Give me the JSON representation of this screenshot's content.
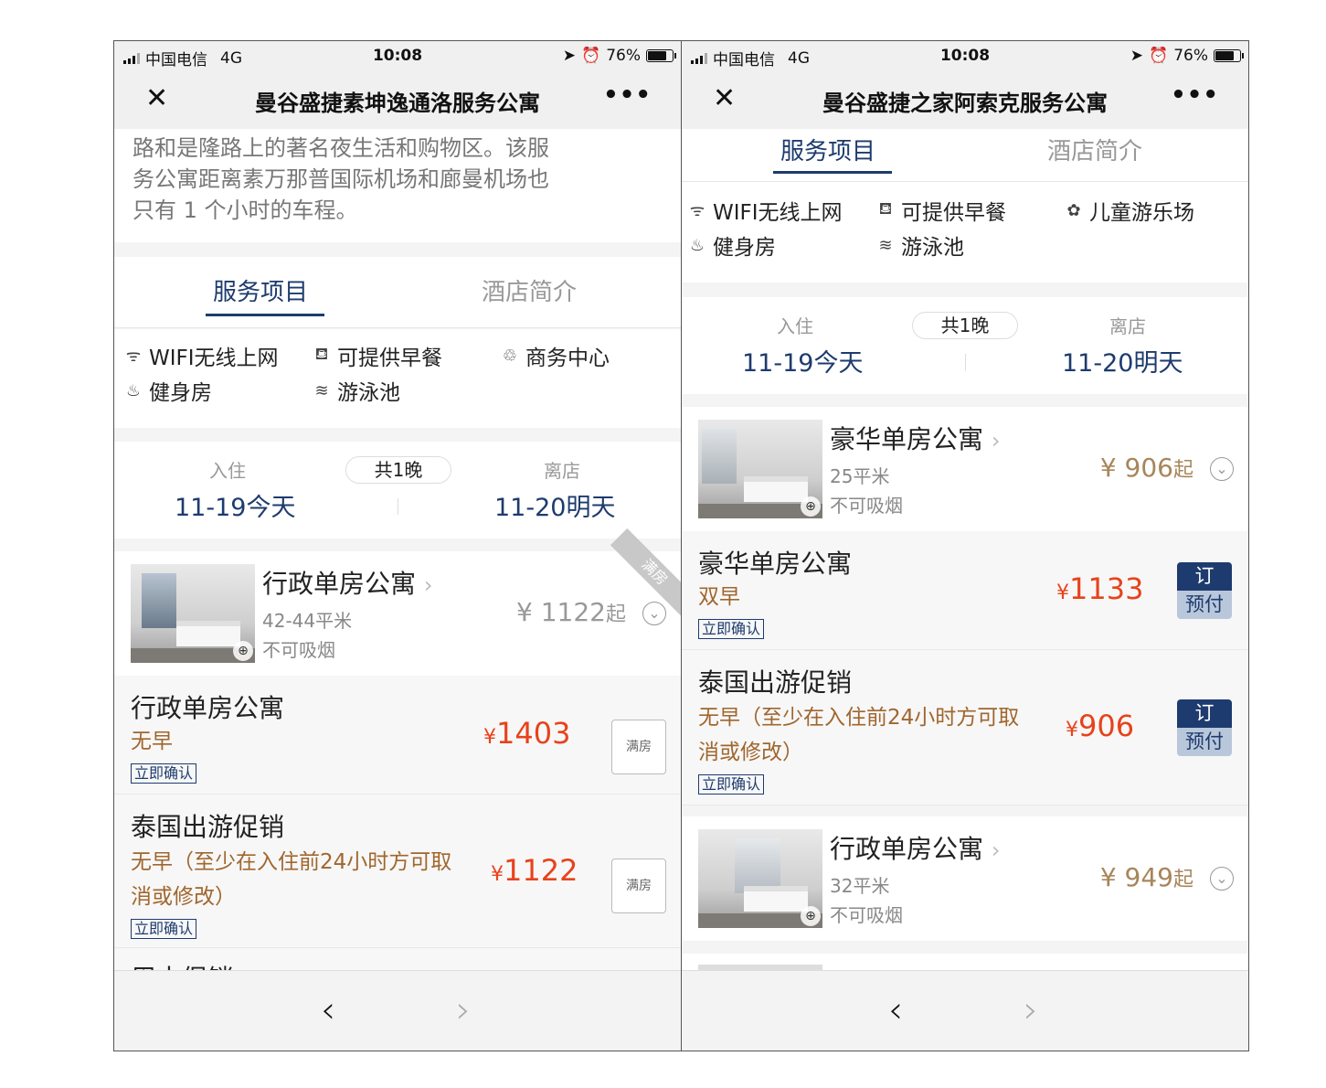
{
  "left": {
    "status": {
      "carrier": "中国电信",
      "network": "4G",
      "time": "10:08",
      "battery": "76%",
      "battery_level": 0.76
    },
    "nav": {
      "close": "✕",
      "title": "曼谷盛捷素坤逸通洛服务公寓",
      "more": "•••"
    },
    "description": [
      "路和是隆路上的著名夜生活和购物区。该服",
      "务公寓距离素万那普国际机场和廊曼机场也",
      "只有 1 个小时的车程。"
    ],
    "tabs": [
      "服务项目",
      "酒店简介"
    ],
    "facilities": [
      {
        "icon": "wifi-icon",
        "glyph": "ᯤ",
        "label": "WIFI无线上网"
      },
      {
        "icon": "breakfast-icon",
        "glyph": "⛾",
        "label": "可提供早餐"
      },
      {
        "icon": "business-icon",
        "glyph": "♲",
        "label": "商务中心"
      },
      {
        "icon": "gym-icon",
        "glyph": "♨",
        "label": "健身房"
      },
      {
        "icon": "pool-icon",
        "glyph": "≋",
        "label": "游泳池"
      }
    ],
    "dates": {
      "checkin_label": "入住",
      "checkin": "11-19今天",
      "nights": "共1晚",
      "checkout_label": "离店",
      "checkout": "11-20明天"
    },
    "room": {
      "name": "行政单房公寓",
      "chev": "›",
      "size": "42-44平米",
      "smoke": "不可吸烟",
      "price": "¥ 1122",
      "qi": "起",
      "ribbon": "满房",
      "expand": "⌄"
    },
    "rates": [
      {
        "name": "行政单房公寓",
        "meal": "无早",
        "meal2": "",
        "confirm": "立即确认",
        "yen": "¥",
        "price": "1403",
        "status": "满房"
      },
      {
        "name": "泰国出游促销",
        "meal": "无早（至少在入住前24小时方可取",
        "meal2": "消或修改）",
        "confirm": "立即确认",
        "yen": "¥",
        "price": "1122",
        "status": "满房"
      }
    ],
    "cut_text": "周末促销",
    "bottom": {
      "back": "‹",
      "forward": "›"
    }
  },
  "right": {
    "status": {
      "carrier": "中国电信",
      "network": "4G",
      "time": "10:08",
      "battery": "76%",
      "battery_level": 0.76
    },
    "nav": {
      "close": "✕",
      "title": "曼谷盛捷之家阿索克服务公寓",
      "more": "•••"
    },
    "tabs": [
      "服务项目",
      "酒店简介"
    ],
    "facilities": [
      {
        "icon": "wifi-icon",
        "glyph": "ᯤ",
        "label": "WIFI无线上网"
      },
      {
        "icon": "breakfast-icon",
        "glyph": "⛾",
        "label": "可提供早餐"
      },
      {
        "icon": "playground-icon",
        "glyph": "✿",
        "label": "儿童游乐场"
      },
      {
        "icon": "gym-icon",
        "glyph": "♨",
        "label": "健身房"
      },
      {
        "icon": "pool-icon",
        "glyph": "≋",
        "label": "游泳池"
      }
    ],
    "dates": {
      "checkin_label": "入住",
      "checkin": "11-19今天",
      "nights": "共1晚",
      "checkout_label": "离店",
      "checkout": "11-20明天"
    },
    "rooms": [
      {
        "name": "豪华单房公寓",
        "chev": "›",
        "size": "25平米",
        "smoke": "不可吸烟",
        "price": "¥ 906",
        "qi": "起",
        "expand": "⌄"
      },
      {
        "name": "行政单房公寓",
        "chev": "›",
        "size": "32平米",
        "smoke": "不可吸烟",
        "price": "¥ 949",
        "qi": "起",
        "expand": "⌄"
      }
    ],
    "rates": [
      {
        "name": "豪华单房公寓",
        "meal": "双早",
        "meal2": "",
        "confirm": "立即确认",
        "yen": "¥",
        "price": "1133",
        "book_top": "订",
        "book_bottom": "预付"
      },
      {
        "name": "泰国出游促销",
        "meal": "无早（至少在入住前24小时方可取",
        "meal2": "消或修改）",
        "confirm": "立即确认",
        "yen": "¥",
        "price": "906",
        "book_top": "订",
        "book_bottom": "预付"
      }
    ],
    "bottom": {
      "back": "‹",
      "forward": "›"
    }
  }
}
